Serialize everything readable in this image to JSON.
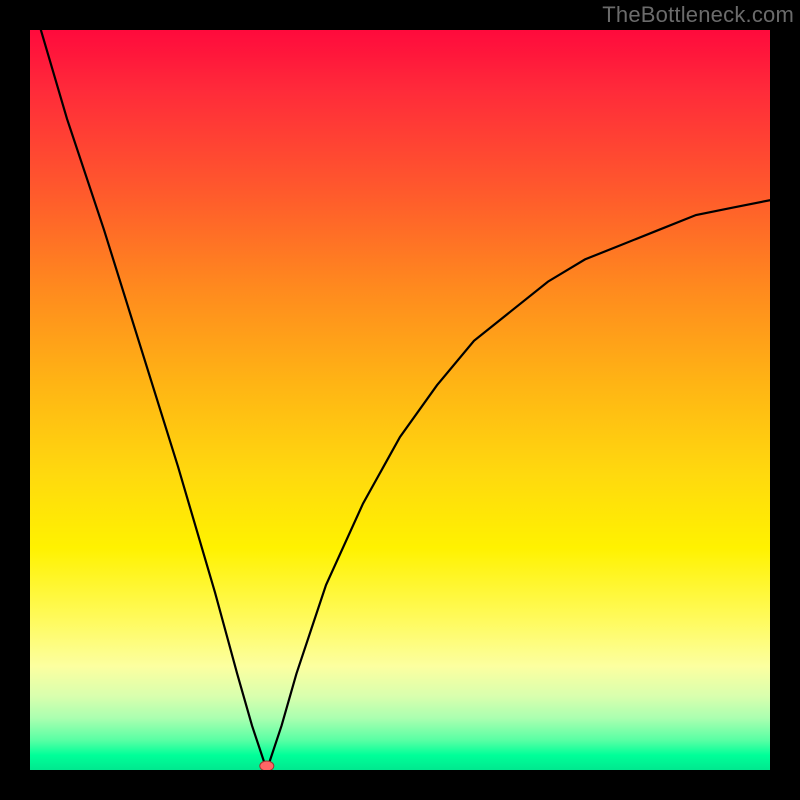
{
  "watermark": "TheBottleneck.com",
  "colors": {
    "background_black": "#000000",
    "gradient_top": "#ff0a3c",
    "gradient_mid": "#ffd90e",
    "gradient_bottom": "#00e88f",
    "curve": "#000000",
    "marker_fill": "#ff6666",
    "marker_stroke": "#a03030",
    "watermark": "#6b6b6b"
  },
  "chart_data": {
    "type": "line",
    "title": "",
    "xlabel": "",
    "ylabel": "",
    "xlim": [
      0,
      100
    ],
    "ylim": [
      0,
      100
    ],
    "grid": false,
    "notes": "V-shaped curve on a vertical rainbow gradient (red top → green bottom). The curve descends steeply from the upper-left, reaches a minimum near x≈32 at y≈0, then rises asymptotically toward y≈77 on the right. A small red marker sits at the minimum. Values are read off the 0–100 normalized axes implied by the plot box.",
    "series": [
      {
        "name": "curve",
        "x": [
          0,
          5,
          10,
          15,
          20,
          25,
          28,
          30,
          32,
          34,
          36,
          38,
          40,
          45,
          50,
          55,
          60,
          65,
          70,
          75,
          80,
          85,
          90,
          95,
          100
        ],
        "y": [
          105,
          88,
          73,
          57,
          41,
          24,
          13,
          6,
          0,
          6,
          13,
          19,
          25,
          36,
          45,
          52,
          58,
          62,
          66,
          69,
          71,
          73,
          75,
          76,
          77
        ]
      }
    ],
    "marker": {
      "x": 32,
      "y": 0
    }
  }
}
